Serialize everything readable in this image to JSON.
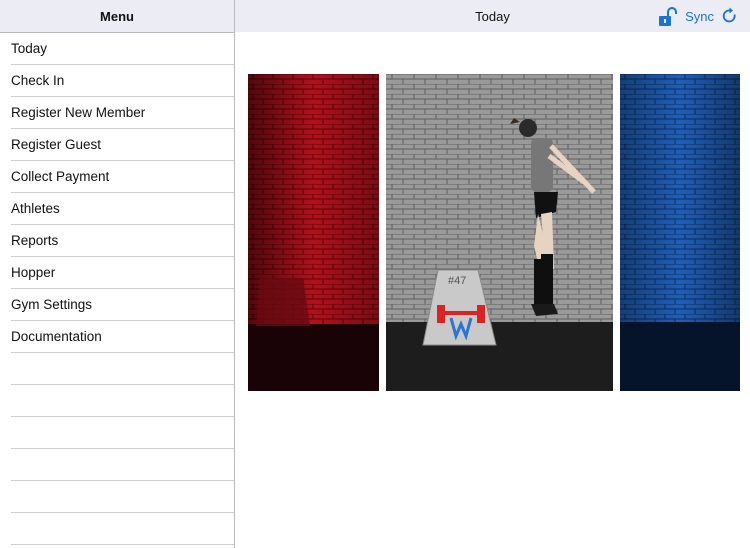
{
  "sidebar": {
    "title": "Menu",
    "items": [
      {
        "label": "Today"
      },
      {
        "label": "Check In"
      },
      {
        "label": "Register New Member"
      },
      {
        "label": "Register Guest"
      },
      {
        "label": "Collect Payment"
      },
      {
        "label": "Athletes"
      },
      {
        "label": "Reports"
      },
      {
        "label": "Hopper"
      },
      {
        "label": "Gym Settings"
      },
      {
        "label": "Documentation"
      }
    ]
  },
  "header": {
    "title": "Today",
    "sync_label": "Sync"
  },
  "images": {
    "box_number": "#47"
  },
  "colors": {
    "accent": "#1a73d9",
    "header_bg": "#ececf4",
    "red_panel": "#c0101c",
    "blue_panel": "#1f5fb8"
  },
  "icons": {
    "lock": "unlocked-padlock-icon",
    "sync": "refresh-icon"
  }
}
